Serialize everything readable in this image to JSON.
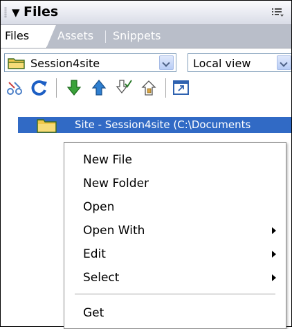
{
  "panel": {
    "title": "Files",
    "collapse_icon": "triangle-down-icon",
    "options_icon": "panel-options-icon"
  },
  "tabs": [
    {
      "label": "Files",
      "active": true
    },
    {
      "label": "Assets",
      "active": false
    },
    {
      "label": "Snippets",
      "active": false
    }
  ],
  "site_select": {
    "value": "Session4site",
    "icon": "site-folder-icon"
  },
  "view_select": {
    "value": "Local view"
  },
  "toolbar": {
    "icons": [
      "connect-icon",
      "refresh-icon",
      "get-files-icon",
      "put-files-icon",
      "check-out-icon",
      "check-in-icon",
      "expand-icon"
    ]
  },
  "file_list": {
    "selected_row_text": "Site - Session4site (C:\\Documents"
  },
  "context_menu": {
    "items": [
      {
        "label": "New File",
        "submenu": false
      },
      {
        "label": "New Folder",
        "submenu": false
      },
      {
        "label": "Open",
        "submenu": false
      },
      {
        "label": "Open With",
        "submenu": true
      },
      {
        "label": "Edit",
        "submenu": true
      },
      {
        "label": "Select",
        "submenu": true
      },
      {
        "label": "Get",
        "submenu": false
      }
    ]
  },
  "colors": {
    "selection": "#316ac5",
    "tab_bar": "#b9bec9",
    "get_arrow": "#3aa23a",
    "put_arrow": "#2f7fd0",
    "refresh": "#1d5fc4",
    "folder": "#f1c84b"
  }
}
